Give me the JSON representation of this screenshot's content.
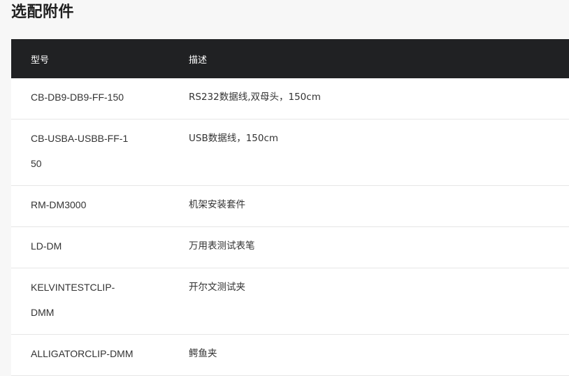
{
  "section": {
    "title": "选配附件"
  },
  "table": {
    "headers": {
      "model": "型号",
      "description": "描述"
    },
    "rows": [
      {
        "model": "CB-DB9-DB9-FF-150",
        "description": "RS232数据线,双母头，150cm"
      },
      {
        "model": "CB-USBA-USBB-FF-150",
        "description": "USB数据线，150cm"
      },
      {
        "model": "RM-DM3000",
        "description": "机架安装套件"
      },
      {
        "model": "LD-DM",
        "description": "万用表测试表笔"
      },
      {
        "model": "KELVINTESTCLIP-DMM",
        "description": "开尔文测试夹"
      },
      {
        "model": "ALLIGATORCLIP-DMM",
        "description": "鳄鱼夹"
      }
    ]
  }
}
